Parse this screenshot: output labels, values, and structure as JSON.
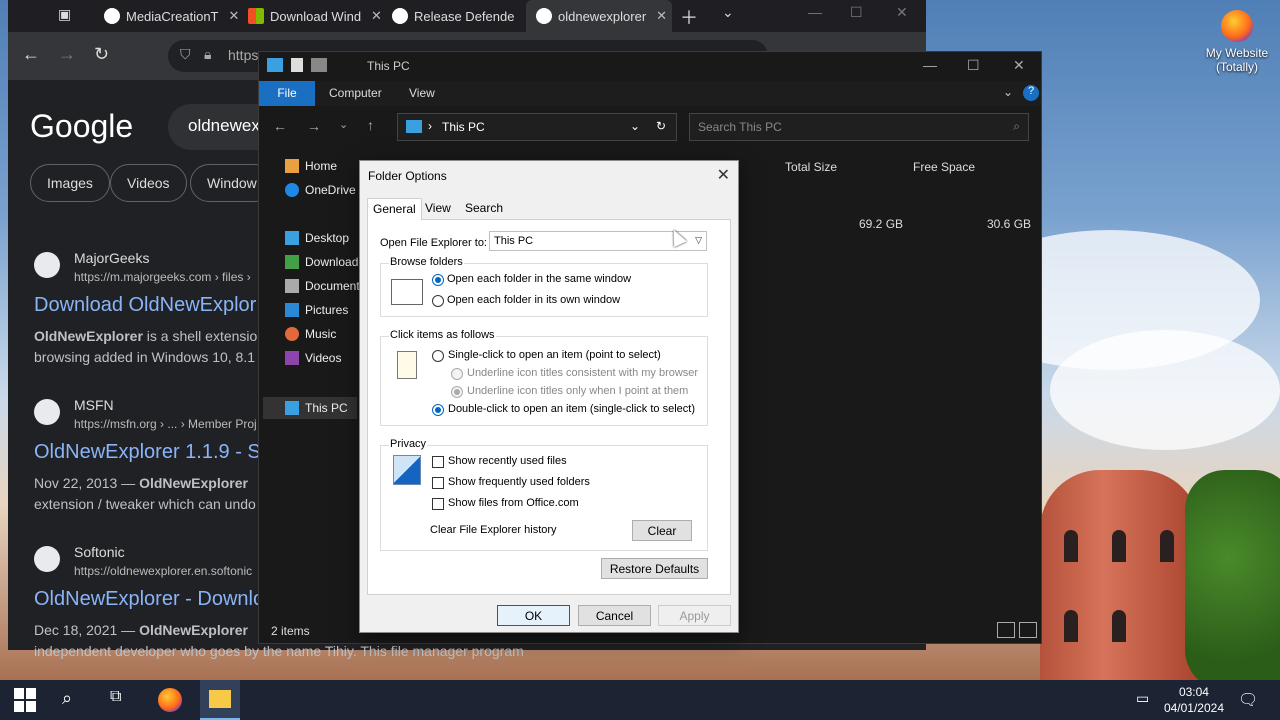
{
  "desktop": {
    "icon_label_line1": "My Website",
    "icon_label_line2": "(Totally)"
  },
  "browser": {
    "tabs": [
      {
        "label": "MediaCreationT",
        "favicon": "github-icon"
      },
      {
        "label": "Download Wind",
        "favicon": "windows-icon"
      },
      {
        "label": "Release Defende",
        "favicon": "github-icon"
      },
      {
        "label": "oldnewexplorer",
        "favicon": "google-icon",
        "active": true
      }
    ],
    "url": "https",
    "google": {
      "logo": "Google",
      "query": "oldnewexp",
      "chips": [
        "Images",
        "Videos",
        "Window"
      ],
      "results": [
        {
          "site": "MajorGeeks",
          "url": "https://m.majorgeeks.com › files ›",
          "title": "Download OldNewExplor",
          "snippet_bold": "OldNewExplorer",
          "snippet_rest": " is a shell extensio",
          "snippet_line2": "browsing added in Windows 10, 8.1"
        },
        {
          "site": "MSFN",
          "url": "https://msfn.org › ... › Member Proj",
          "title": "OldNewExplorer 1.1.9 - S",
          "snippet_prefix": "Nov 22, 2013 — ",
          "snippet_bold": "OldNewExplorer",
          "snippet_rest": "",
          "snippet_line2": "extension / tweaker which can undo"
        },
        {
          "site": "Softonic",
          "url": "https://oldnewexplorer.en.softonic",
          "title": "OldNewExplorer - Downlo",
          "snippet_prefix": "Dec 18, 2021 — ",
          "snippet_bold": "OldNewExplorer",
          "snippet_rest": "",
          "snippet_line2": "independent developer who goes by the name Tihiy. This file manager program"
        }
      ]
    }
  },
  "explorer": {
    "title": "This PC",
    "ribbon_tabs": [
      "File",
      "Computer",
      "View"
    ],
    "address": "This PC",
    "search_placeholder": "Search This PC",
    "nav": {
      "home": "Home",
      "onedrive": "OneDrive",
      "desktop": "Desktop",
      "downloads": "Download",
      "documents": "Document",
      "pictures": "Pictures",
      "music": "Music",
      "videos": "Videos",
      "thispc": "This PC"
    },
    "columns": {
      "total_size": "Total Size",
      "free_space": "Free Space"
    },
    "drive_row": {
      "total_size": "69.2 GB",
      "free_space": "30.6 GB"
    },
    "status": "2 items"
  },
  "dialog": {
    "title": "Folder Options",
    "tabs": [
      "General",
      "View",
      "Search"
    ],
    "open_label": "Open File Explorer to:",
    "open_value": "This PC",
    "browse_group": "Browse folders",
    "browse_same": "Open each folder in the same window",
    "browse_own": "Open each folder in its own window",
    "click_group": "Click items as follows",
    "single_click": "Single-click to open an item (point to select)",
    "underline_browser": "Underline icon titles consistent with my browser",
    "underline_point": "Underline icon titles only when I point at them",
    "double_click": "Double-click to open an item (single-click to select)",
    "privacy_group": "Privacy",
    "recent_files": "Show recently used files",
    "frequent_folders": "Show frequently used folders",
    "office_files": "Show files from Office.com",
    "clear_history": "Clear File Explorer history",
    "clear_btn": "Clear",
    "restore_btn": "Restore Defaults",
    "ok": "OK",
    "cancel": "Cancel",
    "apply": "Apply"
  },
  "taskbar": {
    "time": "03:04",
    "date": "04/01/2024"
  }
}
